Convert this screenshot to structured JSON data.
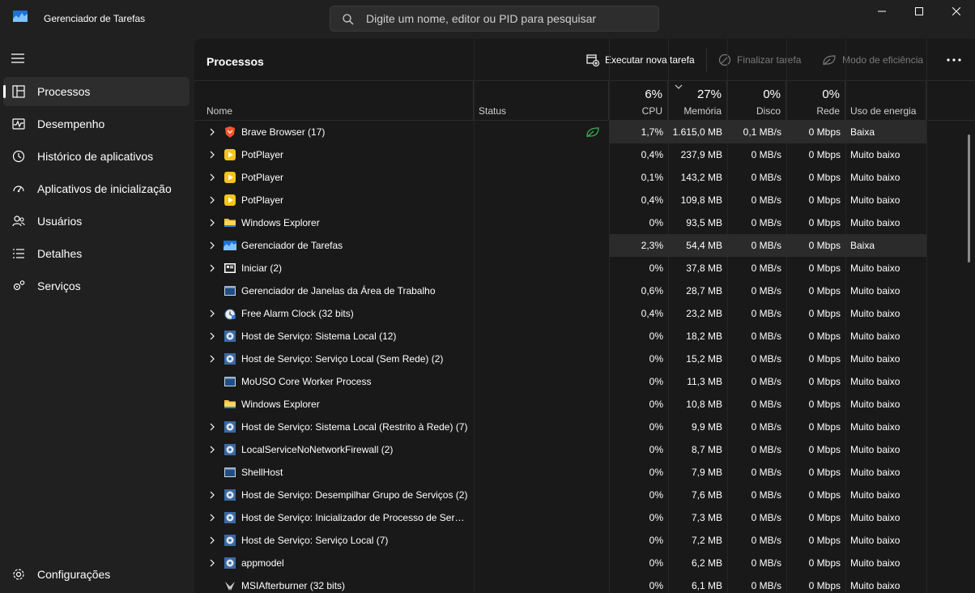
{
  "app": {
    "title": "Gerenciador de Tarefas"
  },
  "search": {
    "placeholder": "Digite um nome, editor ou PID para pesquisar"
  },
  "sidebar": {
    "items": [
      {
        "label": "Processos",
        "icon": "processes-icon",
        "active": true
      },
      {
        "label": "Desempenho",
        "icon": "performance-icon"
      },
      {
        "label": "Histórico de aplicativos",
        "icon": "app-history-icon"
      },
      {
        "label": "Aplicativos de inicialização",
        "icon": "startup-apps-icon"
      },
      {
        "label": "Usuários",
        "icon": "users-icon"
      },
      {
        "label": "Detalhes",
        "icon": "details-icon"
      },
      {
        "label": "Serviços",
        "icon": "services-icon"
      }
    ],
    "settings_label": "Configurações"
  },
  "main": {
    "title": "Processos",
    "toolbar": {
      "run_new_task": "Executar nova tarefa",
      "end_task": "Finalizar tarefa",
      "efficiency_mode": "Modo de eficiência"
    }
  },
  "columns": {
    "name": "Nome",
    "status": "Status",
    "cpu": {
      "pct": "6%",
      "label": "CPU"
    },
    "memory": {
      "pct": "27%",
      "label": "Memória"
    },
    "disk": {
      "pct": "0%",
      "label": "Disco"
    },
    "network": {
      "pct": "0%",
      "label": "Rede"
    },
    "power": "Uso de energia"
  },
  "processes": [
    {
      "name": "Brave Browser (17)",
      "icon": "brave-icon",
      "expandable": true,
      "efficiency": true,
      "cpu": "1,7%",
      "memory": "1.615,0 MB",
      "disk": "0,1 MB/s",
      "network": "0 Mbps",
      "power": "Baixa",
      "heat": true
    },
    {
      "name": "PotPlayer",
      "icon": "potplayer-icon",
      "expandable": true,
      "cpu": "0,4%",
      "memory": "237,9 MB",
      "disk": "0 MB/s",
      "network": "0 Mbps",
      "power": "Muito baixo"
    },
    {
      "name": "PotPlayer",
      "icon": "potplayer-icon",
      "expandable": true,
      "cpu": "0,1%",
      "memory": "143,2 MB",
      "disk": "0 MB/s",
      "network": "0 Mbps",
      "power": "Muito baixo"
    },
    {
      "name": "PotPlayer",
      "icon": "potplayer-icon",
      "expandable": true,
      "cpu": "0,4%",
      "memory": "109,8 MB",
      "disk": "0 MB/s",
      "network": "0 Mbps",
      "power": "Muito baixo"
    },
    {
      "name": "Windows Explorer",
      "icon": "folder-icon",
      "expandable": true,
      "cpu": "0%",
      "memory": "93,5 MB",
      "disk": "0 MB/s",
      "network": "0 Mbps",
      "power": "Muito baixo"
    },
    {
      "name": "Gerenciador de Tarefas",
      "icon": "task-manager-icon",
      "expandable": true,
      "cpu": "2,3%",
      "memory": "54,4 MB",
      "disk": "0 MB/s",
      "network": "0 Mbps",
      "power": "Baixa",
      "heat": true
    },
    {
      "name": "Iniciar (2)",
      "icon": "start-icon",
      "expandable": true,
      "cpu": "0%",
      "memory": "37,8 MB",
      "disk": "0 MB/s",
      "network": "0 Mbps",
      "power": "Muito baixo"
    },
    {
      "name": "Gerenciador de Janelas da Área de Trabalho",
      "icon": "window-icon",
      "expandable": false,
      "cpu": "0,6%",
      "memory": "28,7 MB",
      "disk": "0 MB/s",
      "network": "0 Mbps",
      "power": "Muito baixo"
    },
    {
      "name": "Free Alarm Clock (32 bits)",
      "icon": "alarm-clock-icon",
      "expandable": true,
      "cpu": "0,4%",
      "memory": "23,2 MB",
      "disk": "0 MB/s",
      "network": "0 Mbps",
      "power": "Muito baixo"
    },
    {
      "name": "Host de Serviço: Sistema Local (12)",
      "icon": "service-gear-icon",
      "expandable": true,
      "cpu": "0%",
      "memory": "18,2 MB",
      "disk": "0 MB/s",
      "network": "0 Mbps",
      "power": "Muito baixo"
    },
    {
      "name": "Host de Serviço: Serviço Local (Sem Rede) (2)",
      "icon": "service-gear-icon",
      "expandable": true,
      "cpu": "0%",
      "memory": "15,2 MB",
      "disk": "0 MB/s",
      "network": "0 Mbps",
      "power": "Muito baixo"
    },
    {
      "name": "MoUSO Core Worker Process",
      "icon": "window-icon",
      "expandable": false,
      "cpu": "0%",
      "memory": "11,3 MB",
      "disk": "0 MB/s",
      "network": "0 Mbps",
      "power": "Muito baixo"
    },
    {
      "name": "Windows Explorer",
      "icon": "folder-icon",
      "expandable": false,
      "cpu": "0%",
      "memory": "10,8 MB",
      "disk": "0 MB/s",
      "network": "0 Mbps",
      "power": "Muito baixo"
    },
    {
      "name": "Host de Serviço: Sistema Local (Restrito à Rede) (7)",
      "icon": "service-gear-icon",
      "expandable": true,
      "cpu": "0%",
      "memory": "9,9 MB",
      "disk": "0 MB/s",
      "network": "0 Mbps",
      "power": "Muito baixo"
    },
    {
      "name": "LocalServiceNoNetworkFirewall (2)",
      "icon": "service-gear-icon",
      "expandable": true,
      "cpu": "0%",
      "memory": "8,7 MB",
      "disk": "0 MB/s",
      "network": "0 Mbps",
      "power": "Muito baixo"
    },
    {
      "name": "ShellHost",
      "icon": "window-icon",
      "expandable": false,
      "cpu": "0%",
      "memory": "7,9 MB",
      "disk": "0 MB/s",
      "network": "0 Mbps",
      "power": "Muito baixo"
    },
    {
      "name": "Host de Serviço: Desempilhar Grupo de Serviços (2)",
      "icon": "service-gear-icon",
      "expandable": true,
      "cpu": "0%",
      "memory": "7,6 MB",
      "disk": "0 MB/s",
      "network": "0 Mbps",
      "power": "Muito baixo"
    },
    {
      "name": "Host de Serviço: Inicializador de Processo de Servid...",
      "icon": "service-gear-icon",
      "expandable": true,
      "cpu": "0%",
      "memory": "7,3 MB",
      "disk": "0 MB/s",
      "network": "0 Mbps",
      "power": "Muito baixo"
    },
    {
      "name": "Host de Serviço: Serviço Local (7)",
      "icon": "service-gear-icon",
      "expandable": true,
      "cpu": "0%",
      "memory": "7,2 MB",
      "disk": "0 MB/s",
      "network": "0 Mbps",
      "power": "Muito baixo"
    },
    {
      "name": "appmodel",
      "icon": "service-gear-icon",
      "expandable": true,
      "cpu": "0%",
      "memory": "6,2 MB",
      "disk": "0 MB/s",
      "network": "0 Mbps",
      "power": "Muito baixo"
    },
    {
      "name": "MSIAfterburner (32 bits)",
      "icon": "afterburner-icon",
      "expandable": false,
      "cpu": "0%",
      "memory": "6,1 MB",
      "disk": "0 MB/s",
      "network": "0 Mbps",
      "power": "Muito baixo"
    }
  ],
  "colors": {
    "background": "#202020",
    "panel": "#191919",
    "heat": "#2b2b2b",
    "efficiency_leaf": "#3fae5a"
  }
}
